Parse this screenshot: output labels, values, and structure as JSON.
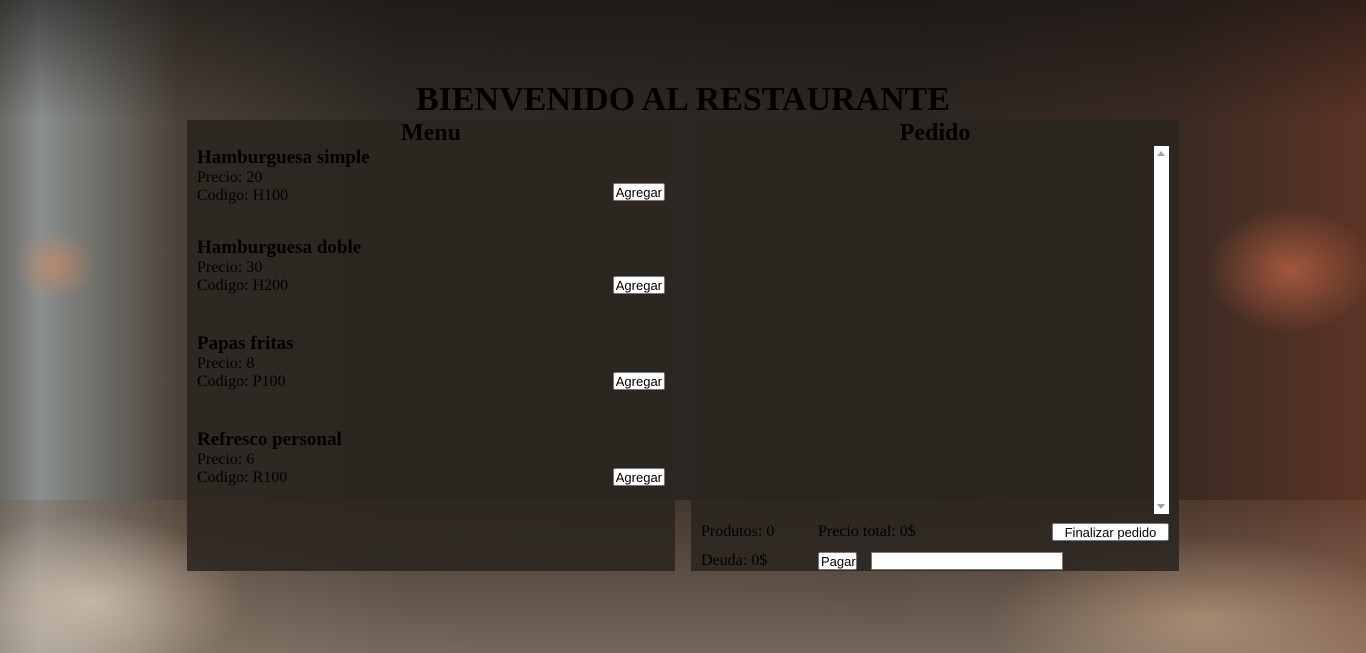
{
  "page": {
    "title": "BIENVENIDO AL RESTAURANTE"
  },
  "menu": {
    "heading": "Menu",
    "items": [
      {
        "name": "Hamburguesa simple",
        "price_label": "Precio: 20",
        "code_label": "Codigo: H100",
        "button": "Agregar"
      },
      {
        "name": "Hamburguesa doble",
        "price_label": "Precio: 30",
        "code_label": "Codigo: H200",
        "button": "Agregar"
      },
      {
        "name": "Papas fritas",
        "price_label": "Precio: 8",
        "code_label": "Codigo: P100",
        "button": "Agregar"
      },
      {
        "name": "Refresco personal",
        "price_label": "Precio: 6",
        "code_label": "Codigo: R100",
        "button": "Agregar"
      }
    ]
  },
  "order": {
    "heading": "Pedido",
    "products_label": "Produtos: 0",
    "total_label": "Precio total: 0$",
    "finish_button": "Finalizar pedido",
    "debt_label": "Deuda: 0$",
    "pay_button": "Pagar",
    "pay_input_value": ""
  }
}
